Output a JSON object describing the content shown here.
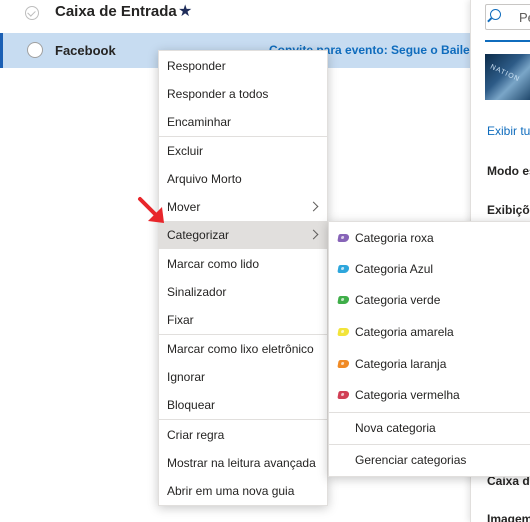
{
  "inbox": {
    "title": "Caixa de Entrada",
    "star": "★"
  },
  "message": {
    "sender": "Facebook",
    "subject": "Convite para evento: Segue o Baile - ..."
  },
  "right_pane": {
    "search_placeholder": "Pe",
    "link_text": "Exibir tu",
    "labels": [
      "Modo es",
      "Exibiçõ",
      "Caixa de",
      "Imagem"
    ],
    "thumb_text": "NATION"
  },
  "context_menu": {
    "items": [
      {
        "label": "Responder"
      },
      {
        "label": "Responder a todos"
      },
      {
        "label": "Encaminhar"
      },
      {
        "label": "Excluir"
      },
      {
        "label": "Arquivo Morto"
      },
      {
        "label": "Mover"
      },
      {
        "label": "Categorizar"
      },
      {
        "label": "Marcar como lido"
      },
      {
        "label": "Sinalizador"
      },
      {
        "label": "Fixar"
      },
      {
        "label": "Marcar como lixo eletrônico"
      },
      {
        "label": "Ignorar"
      },
      {
        "label": "Bloquear"
      },
      {
        "label": "Criar regra"
      },
      {
        "label": "Mostrar na leitura avançada"
      },
      {
        "label": "Abrir em uma nova guia"
      }
    ]
  },
  "category_submenu": {
    "items": [
      {
        "label": "Categoria roxa",
        "color": "#8764b8"
      },
      {
        "label": "Categoria Azul",
        "color": "#2da6dc"
      },
      {
        "label": "Categoria verde",
        "color": "#3fae49"
      },
      {
        "label": "Categoria amarela",
        "color": "#f2e43a"
      },
      {
        "label": "Categoria laranja",
        "color": "#f08a24"
      },
      {
        "label": "Categoria vermelha",
        "color": "#d13f55"
      }
    ],
    "new_category": "Nova categoria",
    "manage_categories": "Gerenciar categorias"
  },
  "colors": {
    "accent": "#0f6cbd",
    "selected_row": "#c7dcf1",
    "pointer_arrow": "#e8262b"
  }
}
